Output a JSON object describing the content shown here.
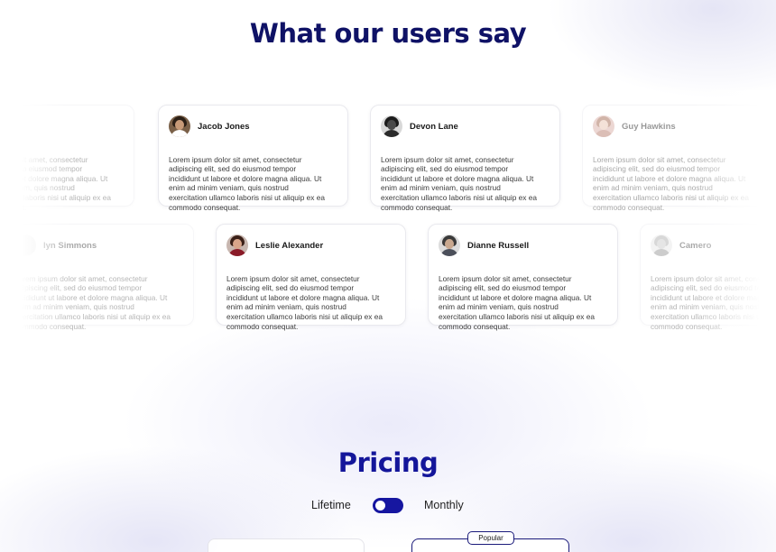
{
  "testimonials": {
    "title": "What our users say",
    "quote": "Lorem ipsum dolor sit amet, consectetur adipiscing elit, sed do eiusmod tempor incididunt ut labore et dolore magna aliqua. Ut enim ad minim veniam, quis nostrud exercitation ullamco laboris nisi ut aliquip ex ea commodo consequat.",
    "quote_lines": [
      "Lorem ipsum dolor sit amet, consectetur",
      "adipiscing elit, sed do eiusmod tempor",
      "incididunt ut labore et dolore magna aliqua. Ut",
      "enim ad minim veniam, quis nostrud",
      "exercitation ullamco laboris nisi ut aliquip ex ea",
      "commodo consequat."
    ],
    "row1": [
      {
        "name": "",
        "visible": "partial-left"
      },
      {
        "name": "Jacob Jones"
      },
      {
        "name": "Devon Lane"
      },
      {
        "name": "Guy Hawkins",
        "visible": "faded"
      }
    ],
    "row2": [
      {
        "name": "lyn Simmons",
        "visible": "partial-left"
      },
      {
        "name": "Leslie Alexander"
      },
      {
        "name": "Dianne Russell"
      },
      {
        "name": "Camero",
        "visible": "partial-right"
      }
    ]
  },
  "pricing": {
    "title": "Pricing",
    "toggle": {
      "left_label": "Lifetime",
      "right_label": "Monthly",
      "selected": "Lifetime"
    },
    "popular_badge": "Popular"
  },
  "colors": {
    "heading": "#0f1266",
    "accent": "#1616a0"
  }
}
